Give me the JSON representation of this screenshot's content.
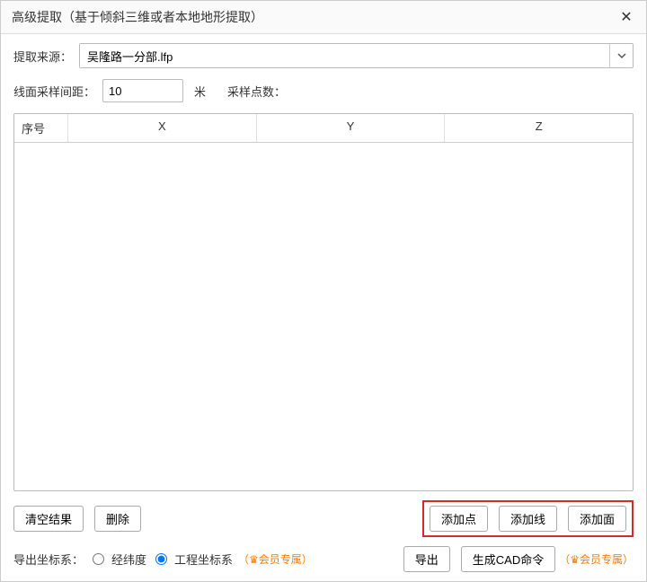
{
  "titlebar": {
    "title": "高级提取（基于倾斜三维或者本地地形提取）"
  },
  "source": {
    "label": "提取来源：",
    "value": "吴隆路一分部.lfp"
  },
  "interval": {
    "label": "线面采样间距：",
    "value": "10",
    "unit": "米"
  },
  "sample_count": {
    "label": "采样点数：",
    "value": ""
  },
  "table": {
    "headers": {
      "seq": "序号",
      "x": "X",
      "y": "Y",
      "z": "Z"
    },
    "rows": []
  },
  "buttons": {
    "clear": "清空结果",
    "delete": "删除",
    "add_point": "添加点",
    "add_line": "添加线",
    "add_face": "添加面",
    "export": "导出",
    "gen_cad": "生成CAD命令"
  },
  "coord": {
    "label": "导出坐标系：",
    "opt_lonlat": "经纬度",
    "opt_eng": "工程坐标系",
    "selected": "eng"
  },
  "vip": {
    "text": "（♛会员专属）"
  }
}
